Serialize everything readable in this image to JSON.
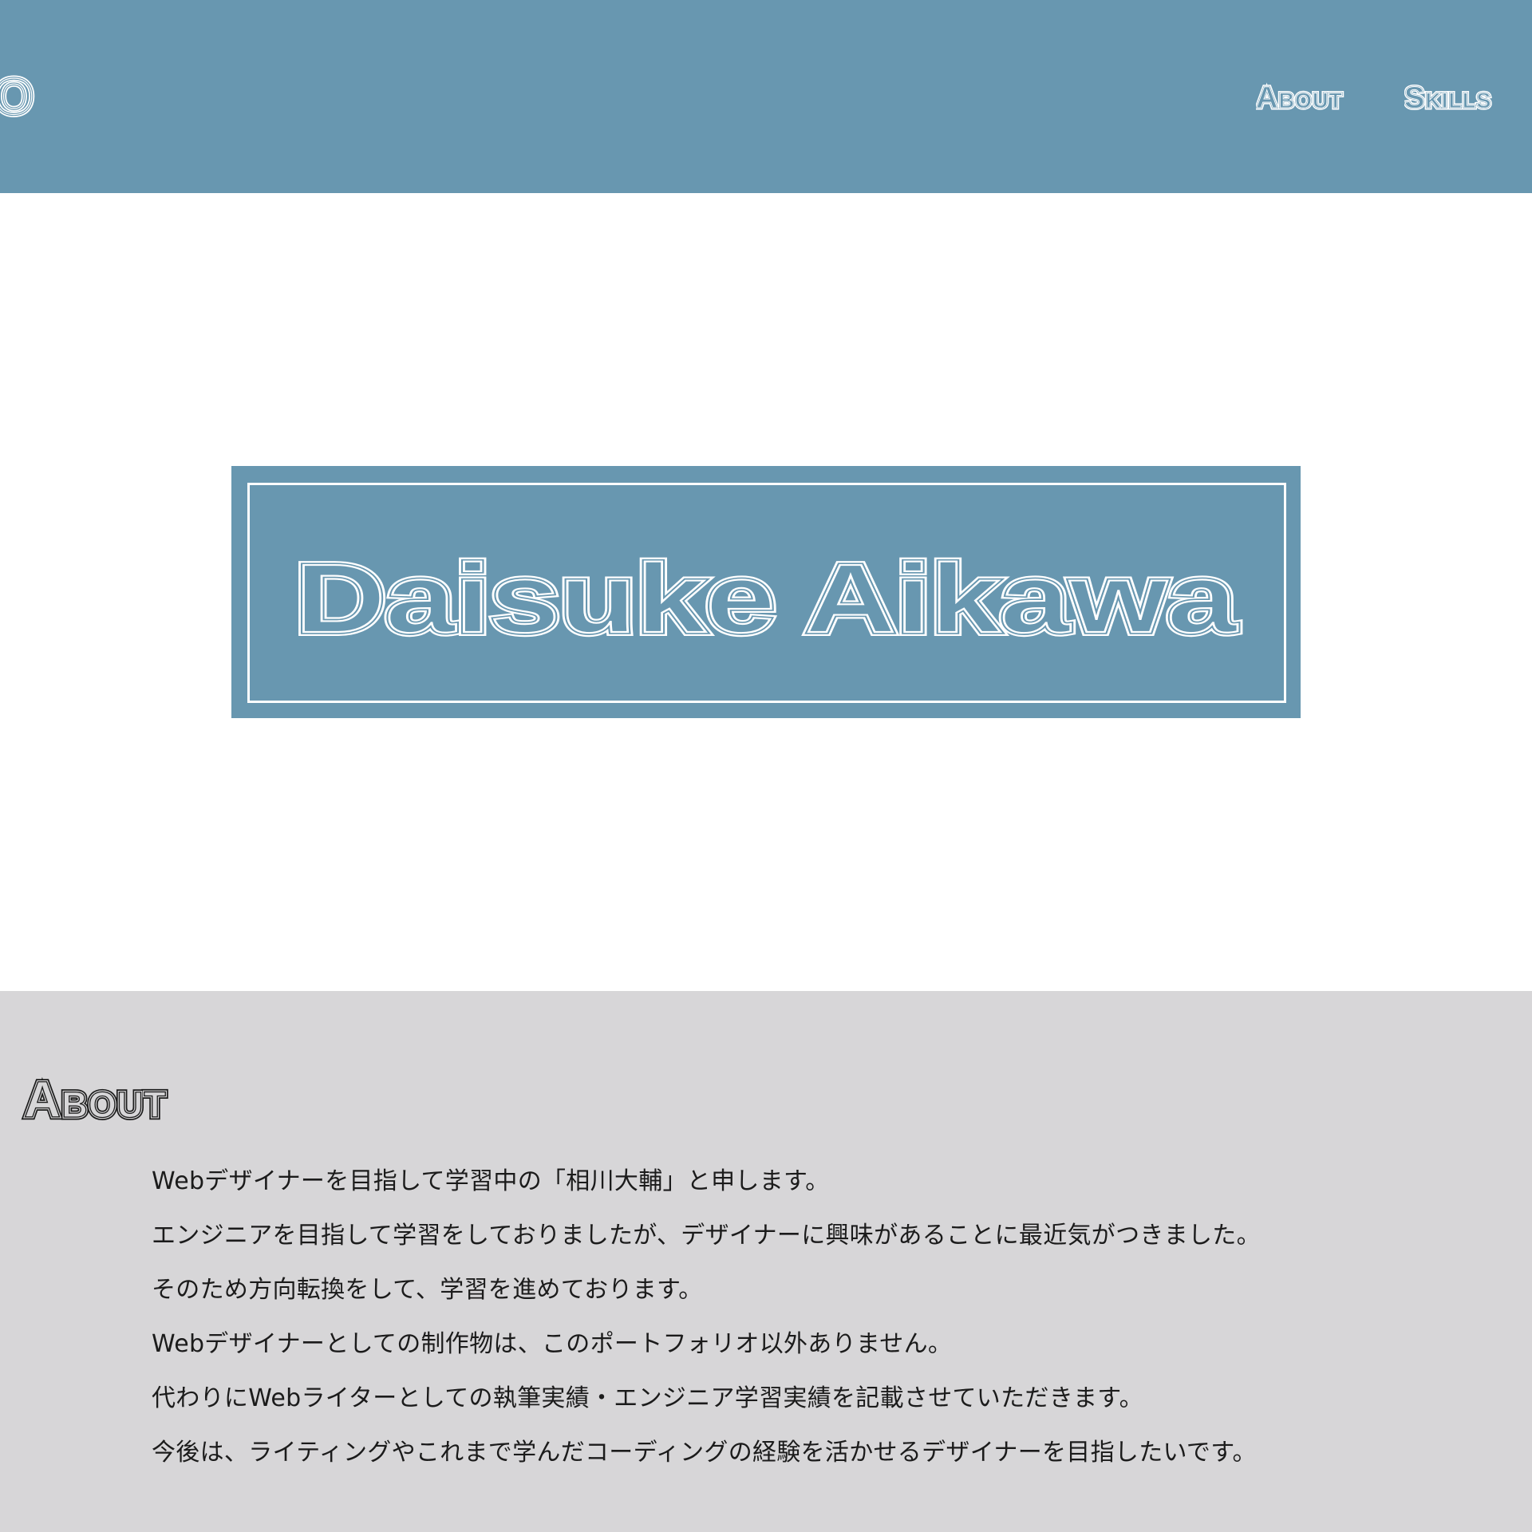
{
  "header": {
    "logo_text": "OLIO",
    "nav": [
      {
        "label": "About"
      },
      {
        "label": "Skills"
      }
    ]
  },
  "hero": {
    "name": "Daisuke Aikawa"
  },
  "about": {
    "heading": "About",
    "lines": [
      "Webデザイナーを目指して学習中の「相川大輔」と申します。",
      "エンジニアを目指して学習をしておりましたが、デザイナーに興味があることに最近気がつきました。",
      "そのため方向転換をして、学習を進めております。",
      "Webデザイナーとしての制作物は、このポートフォリオ以外ありません。",
      "代わりにWebライターとしての執筆実績・エンジニア学習実績を記載させていただきます。",
      "今後は、ライティングやこれまで学んだコーディングの経験を活かせるデザイナーを目指したいです。"
    ]
  },
  "colors": {
    "accent": "#6897b0",
    "section_bg": "#d7d6d8",
    "white": "#ffffff",
    "text": "#1b1b1b"
  }
}
